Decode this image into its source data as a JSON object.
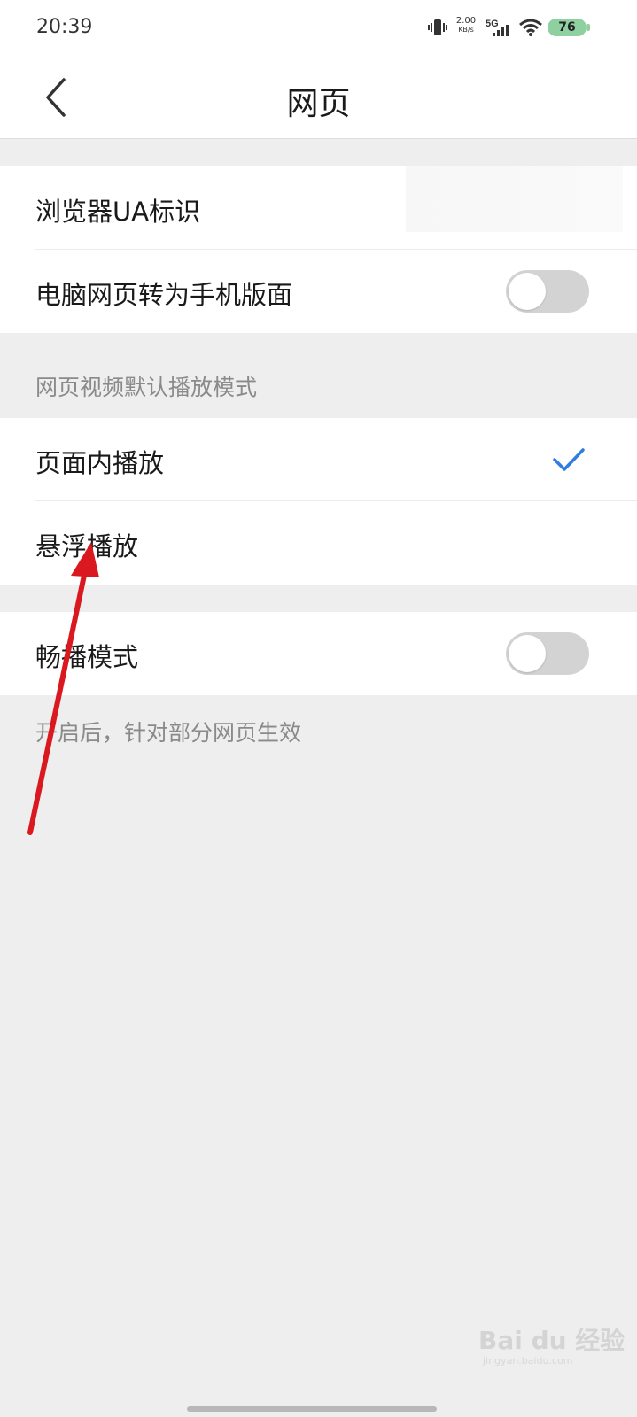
{
  "status_bar": {
    "time": "20:39",
    "net_speed_value": "2.00",
    "net_speed_unit": "KB/s",
    "network_type": "5G",
    "battery_level": "76",
    "icons": [
      "vibrate-icon",
      "signal-icon",
      "wifi-icon",
      "battery-icon"
    ]
  },
  "header": {
    "title": "网页",
    "back_icon": "chevron-left-icon"
  },
  "settings": {
    "ua_label": "浏览器UA标识",
    "desktop_to_mobile_label": "电脑网页转为手机版面",
    "desktop_to_mobile_enabled": false,
    "video_section_header": "网页视频默认播放模式",
    "video_modes": [
      {
        "label": "页面内播放",
        "selected": true
      },
      {
        "label": "悬浮播放",
        "selected": false
      }
    ],
    "smooth_play_label": "畅播模式",
    "smooth_play_enabled": false,
    "smooth_play_note": "开启后，针对部分网页生效"
  },
  "annotation": {
    "arrow_color": "#d9191f"
  },
  "watermark": {
    "text": "Bai du 经验",
    "sub": "jingyan.baidu.com"
  },
  "colors": {
    "accent": "#2f7de1",
    "toggle_off": "#d3d3d3",
    "background": "#eeeeee"
  }
}
